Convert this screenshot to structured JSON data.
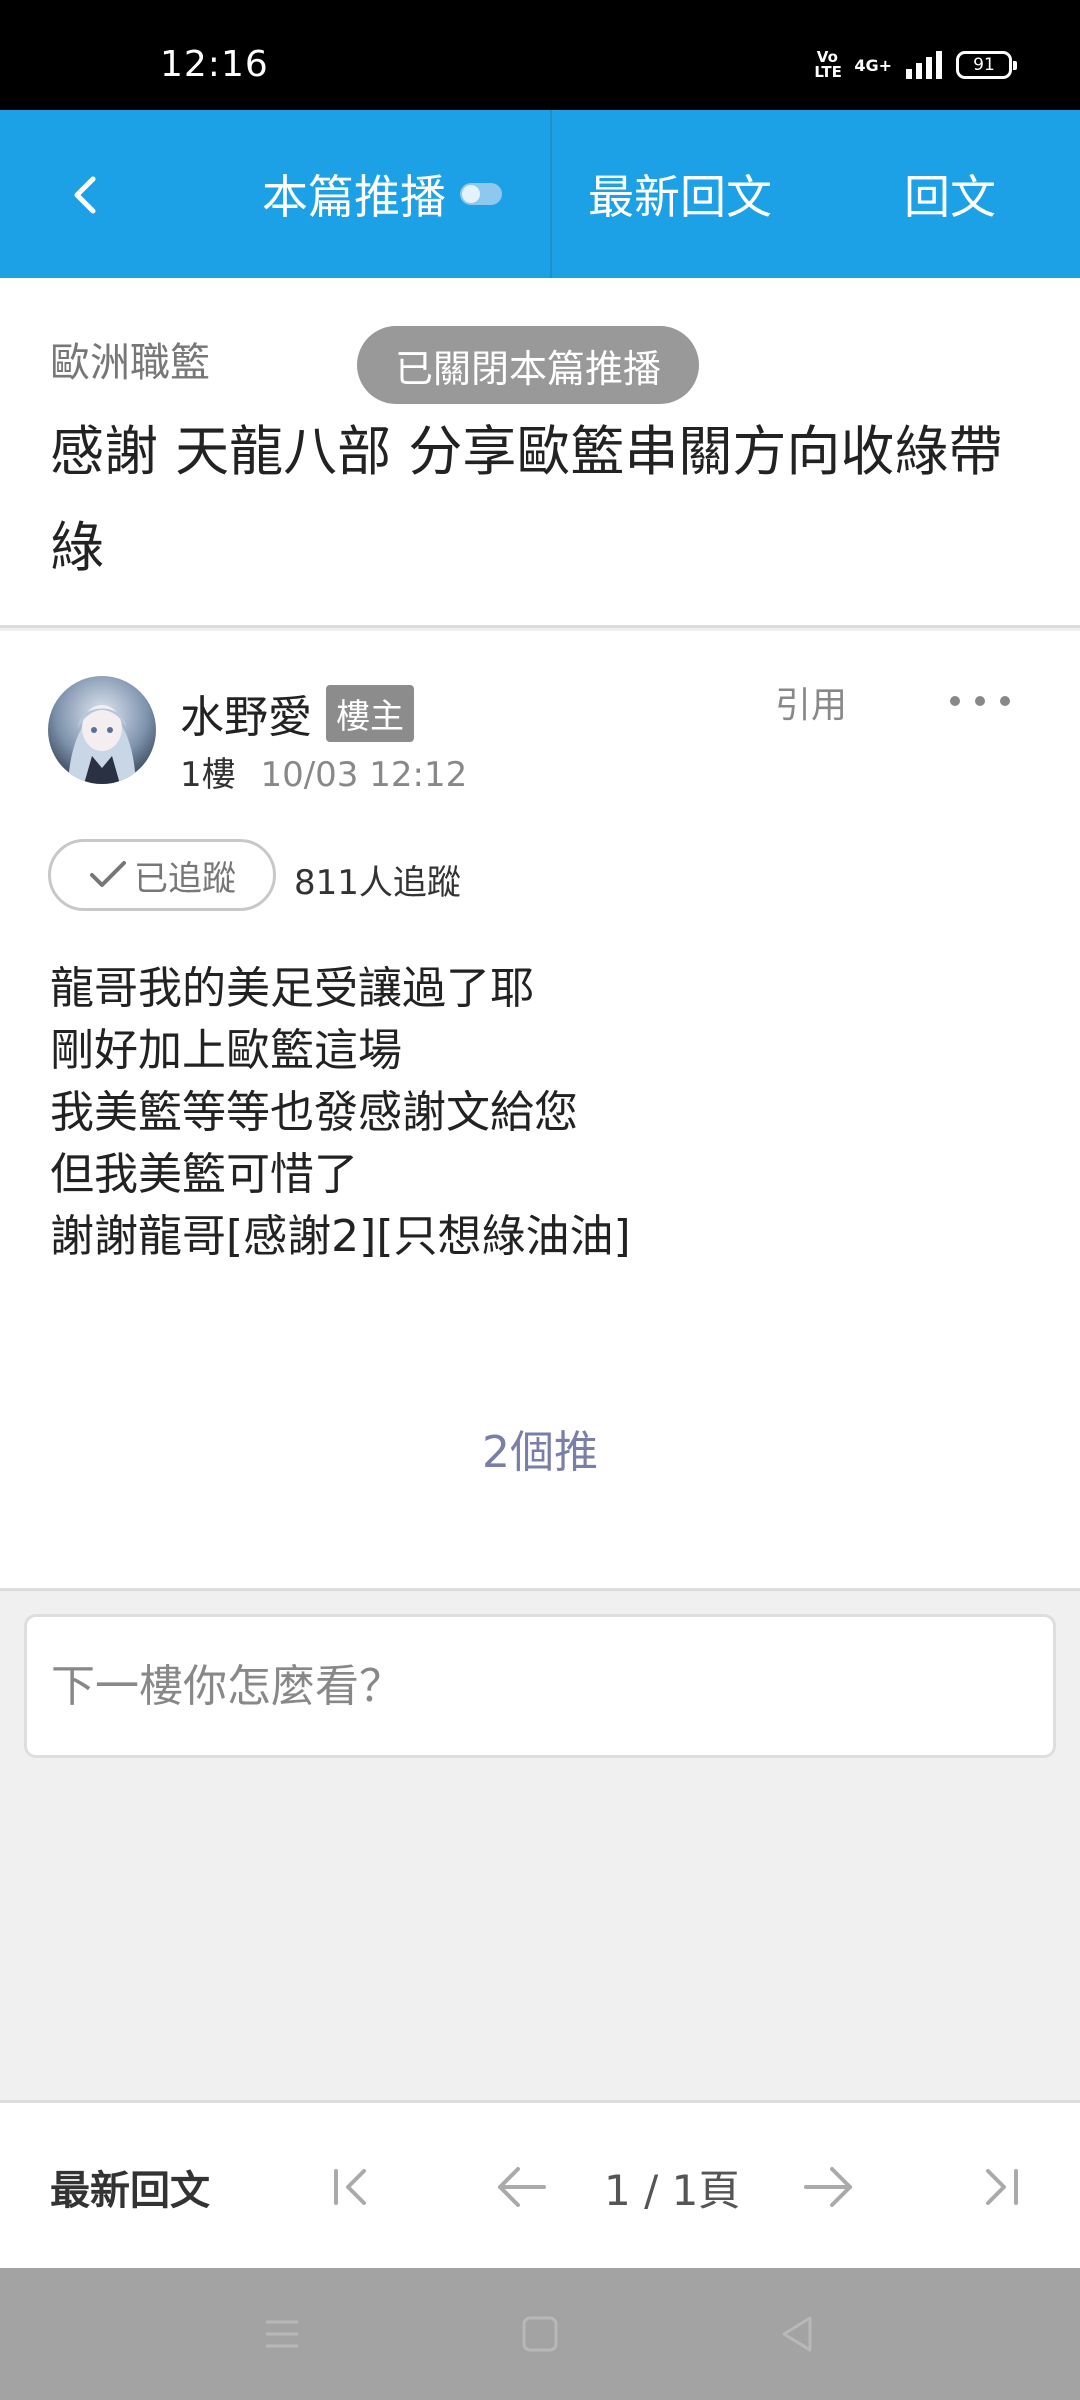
{
  "status_bar": {
    "time": "12:16",
    "volte": "Vo LTE",
    "network": "4G+",
    "battery": "91"
  },
  "header": {
    "back_icon": "chevron-left-icon",
    "tab_push": "本篇推播",
    "tab_latest": "最新回文",
    "tab_reply": "回文",
    "accent_color": "#1da1e6"
  },
  "topic": {
    "board": "歐洲職籃",
    "title": "感謝 天龍八部 分享歐籃串關方向收綠帶綠",
    "toast": "已關閉本篇推播"
  },
  "post": {
    "author": "水野愛",
    "badge": "樓主",
    "floor": "1樓",
    "datetime": "10/03 12:12",
    "quote": "引用",
    "more_icon": "more-dots-icon",
    "follow_label": "已追蹤",
    "follow_count": "811人追蹤",
    "body": [
      "龍哥我的美足受讓過了耶",
      "剛好加上歐籃這場",
      "我美籃等等也發感謝文給您",
      "但我美籃可惜了",
      "謝謝龍哥[感謝2][只想綠油油]"
    ],
    "push_count": "2個推"
  },
  "reply": {
    "placeholder": "下一樓你怎麼看？"
  },
  "pager": {
    "latest": "最新回文",
    "page": "1 / 1頁"
  }
}
